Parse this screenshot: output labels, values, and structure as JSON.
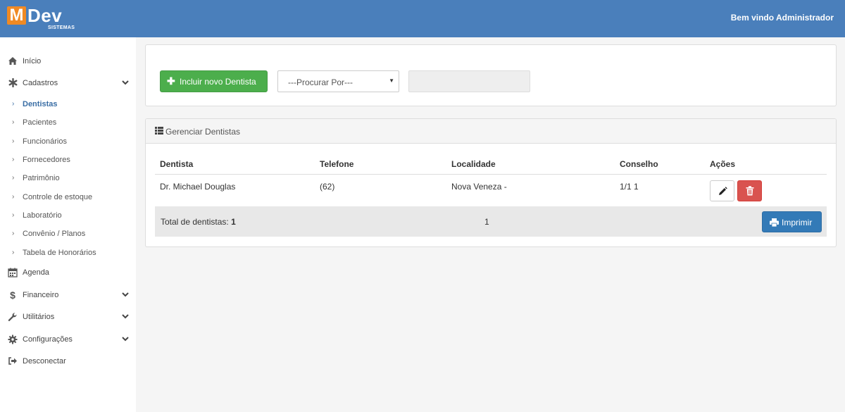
{
  "header": {
    "logo_letter": "M",
    "logo_text": "Dev",
    "logo_sub": "SISTEMAS",
    "welcome": "Bem vindo Administrador"
  },
  "sidebar": {
    "items": [
      {
        "label": "Início",
        "icon": "home-icon"
      },
      {
        "label": "Cadastros",
        "icon": "asterisk-icon"
      },
      {
        "label": "Agenda",
        "icon": "calendar-icon"
      },
      {
        "label": "Financeiro",
        "icon": "dollar-icon"
      },
      {
        "label": "Utilitários",
        "icon": "wrench-icon"
      },
      {
        "label": "Configurações",
        "icon": "gear-icon"
      },
      {
        "label": "Desconectar",
        "icon": "sign-out-icon"
      }
    ],
    "submenu": [
      "Dentistas",
      "Pacientes",
      "Funcionários",
      "Fornecedores",
      "Patrimônio",
      "Controle de estoque",
      "Laboratório",
      "Convênio / Planos",
      "Tabela de Honorários"
    ],
    "active_submenu": "Dentistas"
  },
  "toolbar": {
    "add_label": "Incluir novo Dentista",
    "search_by": "---Procurar Por---",
    "search_value": ""
  },
  "panel": {
    "title": "Gerenciar Dentistas",
    "columns": [
      "Dentista",
      "Telefone",
      "Localidade",
      "Conselho",
      "Ações"
    ],
    "rows": [
      {
        "dentista": "Dr. Michael Douglas",
        "telefone": "(62)",
        "localidade": "Nova Veneza -",
        "conselho": "1/1 1"
      }
    ],
    "total_label": "Total de dentistas:",
    "total_value": "1",
    "page": "1",
    "print_label": "Imprimir"
  },
  "colors": {
    "header": "#4a7fbb",
    "logo_accent": "#f08a24",
    "success": "#4cae4c",
    "danger": "#d9534f",
    "primary": "#337ab7",
    "active_link": "#3a6ea5"
  }
}
